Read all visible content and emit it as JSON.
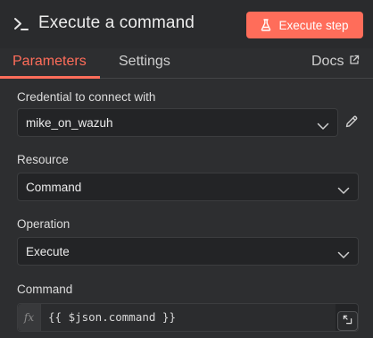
{
  "header": {
    "title": "Execute a command",
    "title_icon": "terminal-icon",
    "execute_label": "Execute step",
    "execute_icon": "flask-icon",
    "accent": "#ff6d5a"
  },
  "tabs": {
    "parameters": "Parameters",
    "settings": "Settings",
    "docs": "Docs",
    "active": "Parameters"
  },
  "fields": {
    "credential": {
      "label": "Credential to connect with",
      "value": "mike_on_wazuh"
    },
    "resource": {
      "label": "Resource",
      "value": "Command"
    },
    "operation": {
      "label": "Operation",
      "value": "Execute"
    },
    "command": {
      "label": "Command",
      "fx": "fx",
      "value": "{{ $json.command }}"
    }
  }
}
